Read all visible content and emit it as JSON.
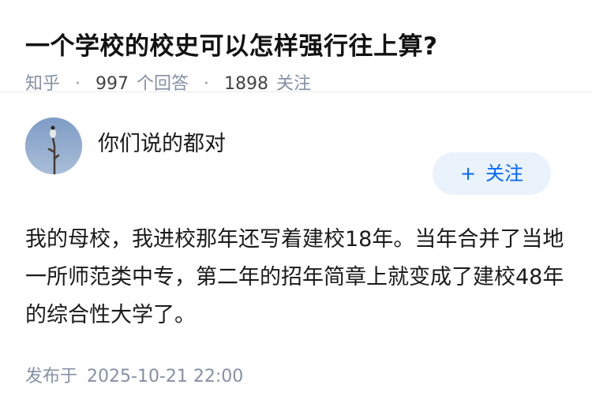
{
  "question": {
    "title": "一个学校的校史可以怎样强行往上算?",
    "source": "知乎",
    "separator": "·",
    "answers_count": "997",
    "answers_label": "个回答",
    "followers_count": "1898",
    "followers_label": "关注"
  },
  "author": {
    "name": "你们说的都对",
    "avatar_icon": "bird-on-branch-avatar",
    "follow_plus": "+",
    "follow_label": "关注",
    "accent_color": "#0066ff"
  },
  "answer": {
    "content": "我的母校，我进校那年还写着建校18年。当年合并了当地一所师范类中专，第二年的招年简章上就变成了建校48年的综合性大学了。",
    "published_label": "发布于",
    "published_date": "2025-10-21 22:00"
  }
}
